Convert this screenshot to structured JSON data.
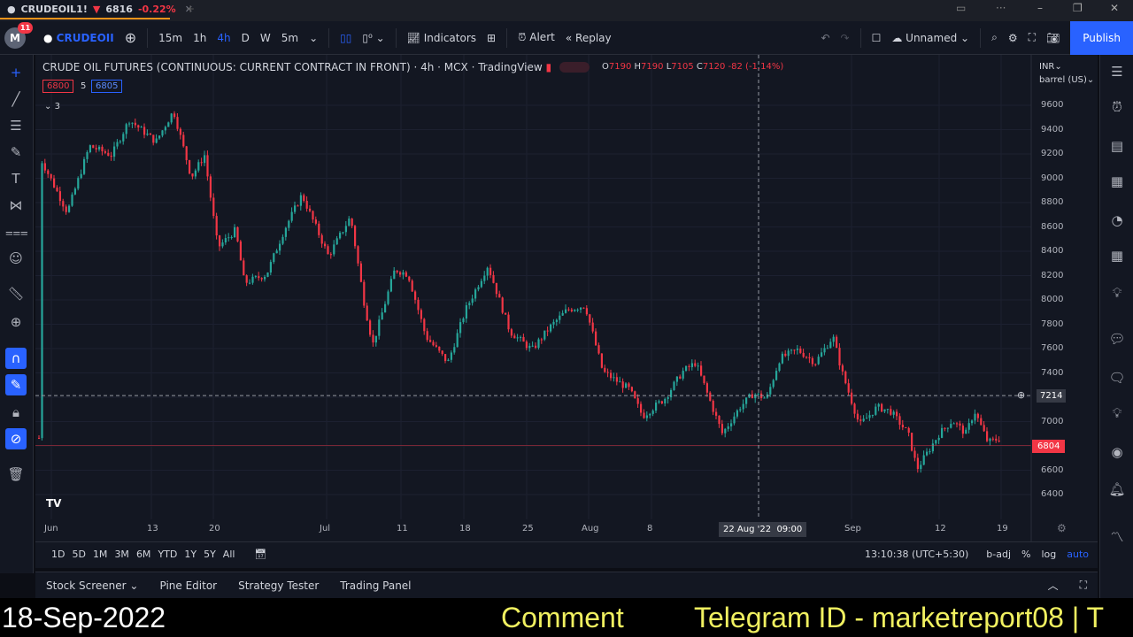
{
  "tab": {
    "symbol": "CRUDEOIL1!",
    "price": "6816",
    "change": "-0.22%"
  },
  "toolbar": {
    "avatar": "M",
    "notifications": "11",
    "symbol": "CRUDEOII",
    "intervals": [
      "15m",
      "1h",
      "4h",
      "D",
      "W",
      "5m"
    ],
    "active_interval": "4h",
    "indicators": "Indicators",
    "alert": "Alert",
    "replay": "Replay",
    "layout_name": "Unnamed",
    "publish": "Publish"
  },
  "legend": {
    "title": "CRUDE OIL FUTURES (CONTINUOUS: CURRENT CONTRACT IN FRONT)",
    "interval": "4h",
    "exchange": "MCX",
    "source": "TradingView",
    "o_label": "O",
    "o": "7190",
    "h_label": "H",
    "h": "7190",
    "l_label": "L",
    "l": "7105",
    "c_label": "C",
    "c": "7120",
    "change": "-82 (-1.14%)",
    "bid": "6800",
    "spread": "5",
    "ask": "6805",
    "collapsed_count": "3"
  },
  "price_axis": {
    "currency": "INR",
    "unit": "barrel (US)",
    "ticks": [
      "9600",
      "9400",
      "9200",
      "9000",
      "8800",
      "8600",
      "8400",
      "8200",
      "8000",
      "7800",
      "7600",
      "7400",
      "7200",
      "7000",
      "6800",
      "6600",
      "6400"
    ],
    "crosshair_price": "7214",
    "last_price": "6804"
  },
  "time_axis": {
    "ticks": [
      "Jun",
      "13",
      "20",
      "Jul",
      "11",
      "18",
      "25",
      "Aug",
      "8",
      "Sep",
      "12",
      "19"
    ],
    "crosshair_label": "22 Aug '22  09:00"
  },
  "range_bar": {
    "ranges": [
      "1D",
      "5D",
      "1M",
      "3M",
      "6M",
      "YTD",
      "1Y",
      "5Y",
      "All"
    ],
    "clock": "13:10:38 (UTC+5:30)",
    "badj": "b-adj",
    "percent": "%",
    "log": "log",
    "auto": "auto"
  },
  "bottom_tabs": [
    "Stock Screener",
    "Pine Editor",
    "Strategy Tester",
    "Trading Panel"
  ],
  "ticker": {
    "date": "18-Sep-2022",
    "scroll": "Comment",
    "telegram": "Telegram ID - marketreport08 | T"
  },
  "colors": {
    "up": "#26a69a",
    "down": "#f23645",
    "accent": "#2962ff",
    "background": "#131722"
  }
}
